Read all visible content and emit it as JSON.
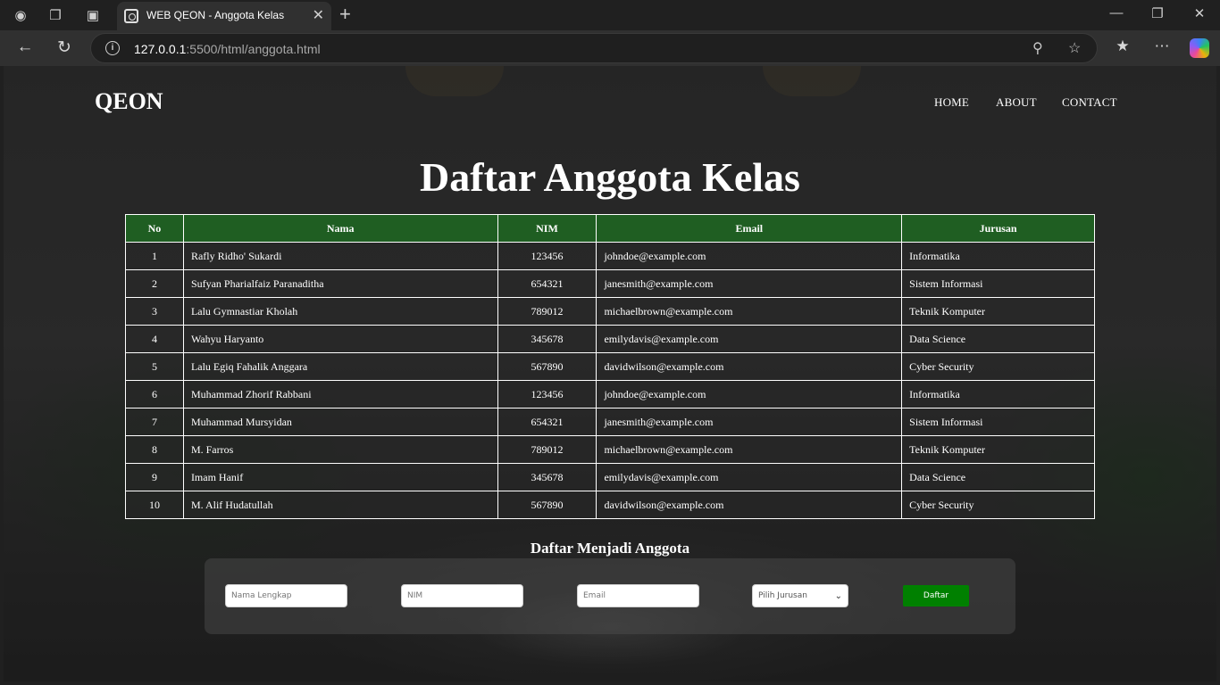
{
  "browser": {
    "tab_title": "WEB QEON - Anggota Kelas",
    "url_host": "127.0.0.1",
    "url_path": ":5500/html/anggota.html"
  },
  "header": {
    "logo": "QEON",
    "nav": [
      "HOME",
      "ABOUT",
      "CONTACT"
    ]
  },
  "main": {
    "title": "Daftar Anggota Kelas",
    "columns": [
      "No",
      "Nama",
      "NIM",
      "Email",
      "Jurusan"
    ],
    "rows": [
      [
        "1",
        "Rafly Ridho' Sukardi",
        "123456",
        "johndoe@example.com",
        "Informatika"
      ],
      [
        "2",
        "Sufyan Pharialfaiz Paranaditha",
        "654321",
        "janesmith@example.com",
        "Sistem Informasi"
      ],
      [
        "3",
        "Lalu Gymnastiar Kholah",
        "789012",
        "michaelbrown@example.com",
        "Teknik Komputer"
      ],
      [
        "4",
        "Wahyu Haryanto",
        "345678",
        "emilydavis@example.com",
        "Data Science"
      ],
      [
        "5",
        "Lalu Egiq Fahalik Anggara",
        "567890",
        "davidwilson@example.com",
        "Cyber Security"
      ],
      [
        "6",
        "Muhammad Zhorif Rabbani",
        "123456",
        "johndoe@example.com",
        "Informatika"
      ],
      [
        "7",
        "Muhammad Mursyidan",
        "654321",
        "janesmith@example.com",
        "Sistem Informasi"
      ],
      [
        "8",
        "M. Farros",
        "789012",
        "michaelbrown@example.com",
        "Teknik Komputer"
      ],
      [
        "9",
        "Imam Hanif",
        "345678",
        "emilydavis@example.com",
        "Data Science"
      ],
      [
        "10",
        "M. Alif Hudatullah",
        "567890",
        "davidwilson@example.com",
        "Cyber Security"
      ]
    ]
  },
  "form": {
    "title": "Daftar Menjadi Anggota",
    "name_placeholder": "Nama Lengkap",
    "nim_placeholder": "NIM",
    "email_placeholder": "Email",
    "jurusan_selected": "Pilih Jurusan",
    "submit_label": "Daftar"
  },
  "colors": {
    "table_header": "#1f5e22",
    "submit_button": "#008000"
  }
}
